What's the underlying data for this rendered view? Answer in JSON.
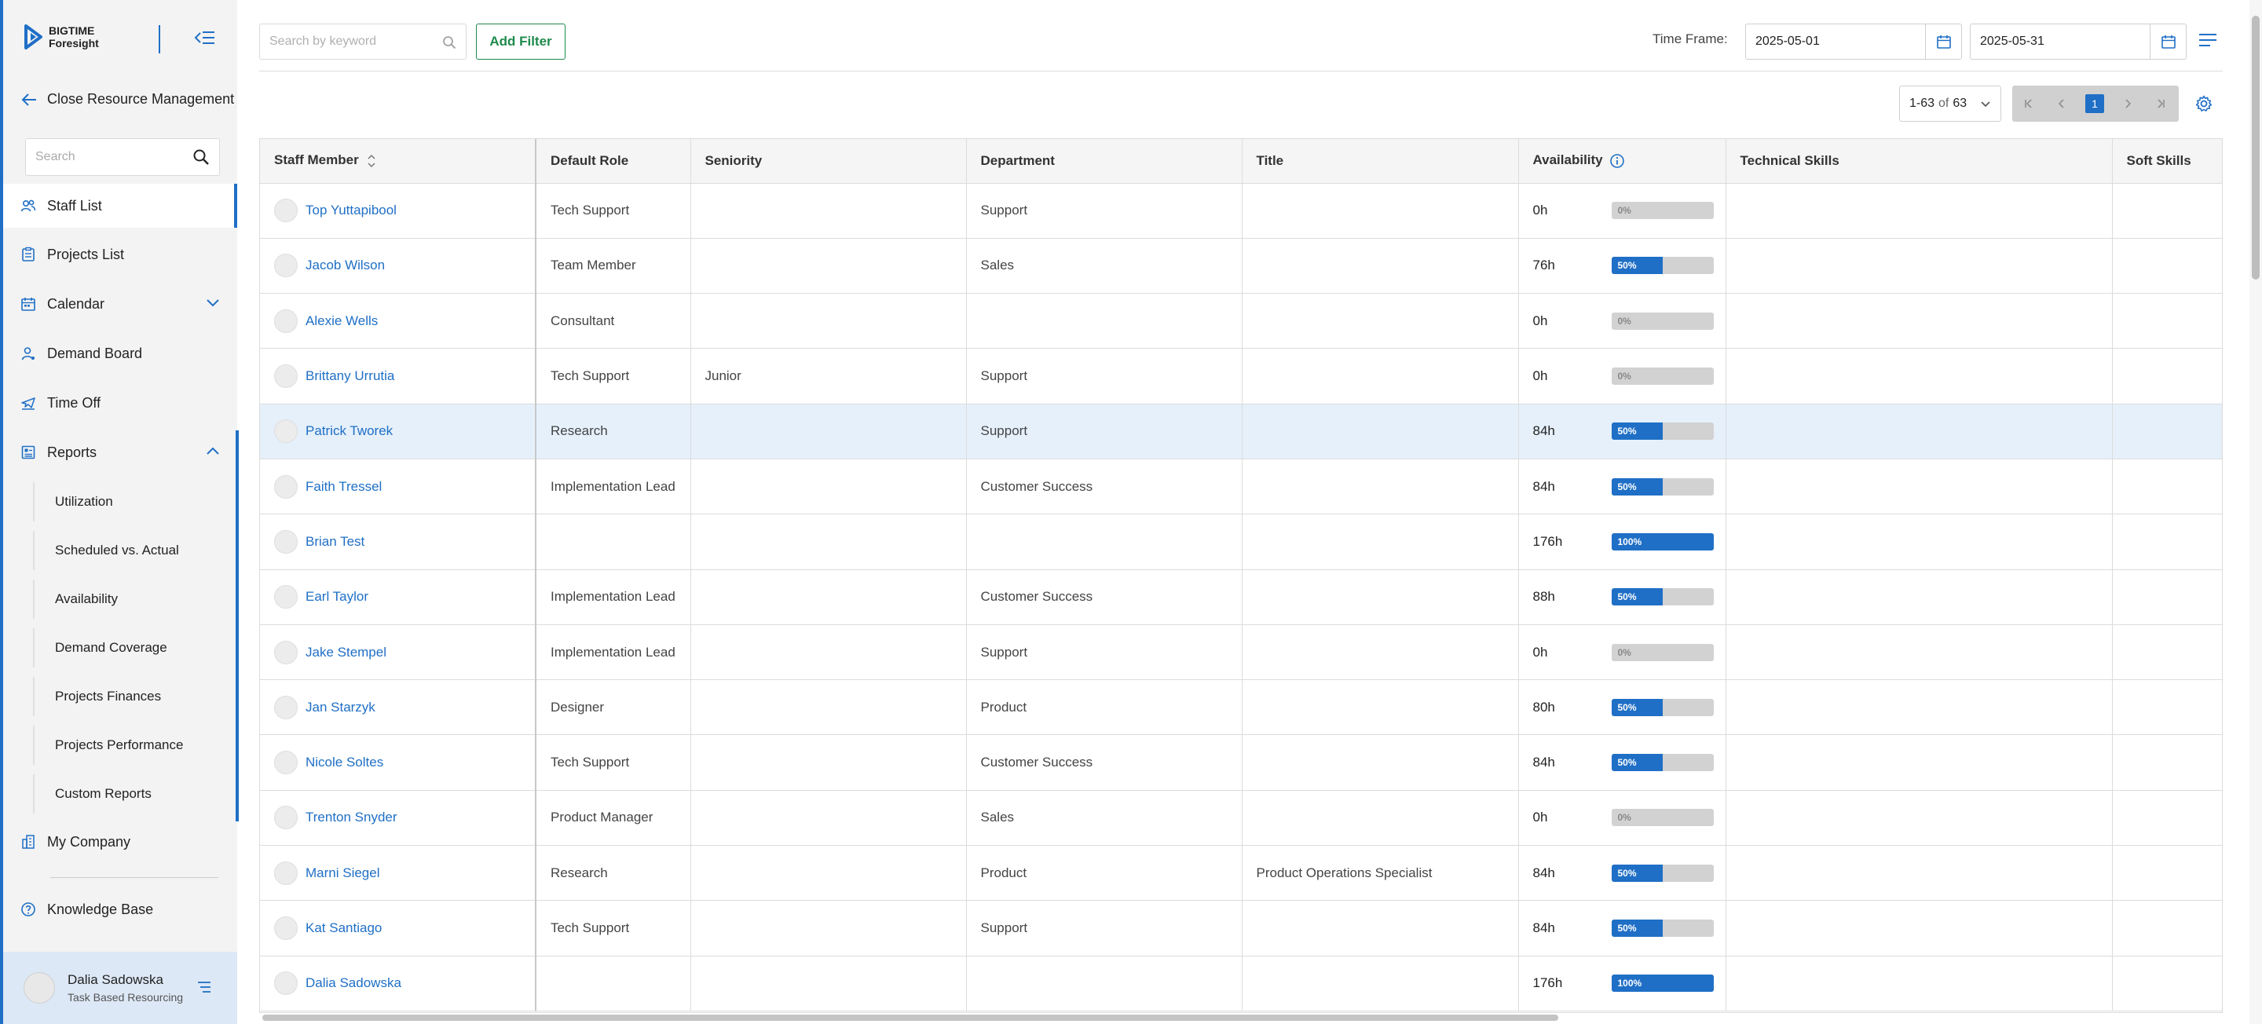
{
  "brand": {
    "line1": "BIGTIME",
    "line2": "Foresight"
  },
  "sidebar": {
    "back_label": "Close Resource Management",
    "search_placeholder": "Search",
    "items": [
      {
        "label": "Staff List",
        "icon": "users-icon",
        "active": true
      },
      {
        "label": "Projects List",
        "icon": "clipboard-icon"
      },
      {
        "label": "Calendar",
        "icon": "calendar-icon",
        "expanded": false
      },
      {
        "label": "Demand Board",
        "icon": "person-icon"
      },
      {
        "label": "Time Off",
        "icon": "plane-icon"
      },
      {
        "label": "Reports",
        "icon": "report-icon",
        "expanded": true
      }
    ],
    "report_items": [
      "Utilization",
      "Scheduled vs. Actual",
      "Availability",
      "Demand Coverage",
      "Projects Finances",
      "Projects Performance",
      "Custom Reports"
    ],
    "my_company": "My Company",
    "knowledge_base": "Knowledge Base",
    "user": {
      "name": "Dalia Sadowska",
      "role": "Task Based Resourcing"
    }
  },
  "toolbar": {
    "search_placeholder": "Search by keyword",
    "add_filter_label": "Add Filter",
    "time_frame_label": "Time Frame:",
    "start_date": "2025-05-01",
    "end_date": "2025-05-31"
  },
  "pagination": {
    "range": "1-63",
    "of_label": "of",
    "total": "63",
    "current_page": "1"
  },
  "table": {
    "columns": [
      "Staff Member",
      "Default Role",
      "Seniority",
      "Department",
      "Title",
      "Availability",
      "Technical Skills",
      "Soft Skills"
    ],
    "rows": [
      {
        "name": "Top Yuttapibool",
        "role": "Tech Support",
        "seniority": "",
        "department": "Support",
        "title": "",
        "hours": "0h",
        "pct": "0%",
        "fill": 0
      },
      {
        "name": "Jacob Wilson",
        "role": "Team Member",
        "seniority": "",
        "department": "Sales",
        "title": "",
        "hours": "76h",
        "pct": "50%",
        "fill": 0.5
      },
      {
        "name": "Alexie Wells",
        "role": "Consultant",
        "seniority": "",
        "department": "",
        "title": "",
        "hours": "0h",
        "pct": "0%",
        "fill": 0
      },
      {
        "name": "Brittany Urrutia",
        "role": "Tech Support",
        "seniority": "Junior",
        "department": "Support",
        "title": "",
        "hours": "0h",
        "pct": "0%",
        "fill": 0
      },
      {
        "name": "Patrick Tworek",
        "role": "Research",
        "seniority": "",
        "department": "Support",
        "title": "",
        "hours": "84h",
        "pct": "50%",
        "fill": 0.5,
        "highlight": true
      },
      {
        "name": "Faith Tressel",
        "role": "Implementation Lead",
        "seniority": "",
        "department": "Customer Success",
        "title": "",
        "hours": "84h",
        "pct": "50%",
        "fill": 0.5
      },
      {
        "name": "Brian Test",
        "role": "",
        "seniority": "",
        "department": "",
        "title": "",
        "hours": "176h",
        "pct": "100%",
        "fill": 1
      },
      {
        "name": "Earl Taylor",
        "role": "Implementation Lead",
        "seniority": "",
        "department": "Customer Success",
        "title": "",
        "hours": "88h",
        "pct": "50%",
        "fill": 0.5
      },
      {
        "name": "Jake Stempel",
        "role": "Implementation Lead",
        "seniority": "",
        "department": "Support",
        "title": "",
        "hours": "0h",
        "pct": "0%",
        "fill": 0
      },
      {
        "name": "Jan Starzyk",
        "role": "Designer",
        "seniority": "",
        "department": "Product",
        "title": "",
        "hours": "80h",
        "pct": "50%",
        "fill": 0.5
      },
      {
        "name": "Nicole Soltes",
        "role": "Tech Support",
        "seniority": "",
        "department": "Customer Success",
        "title": "",
        "hours": "84h",
        "pct": "50%",
        "fill": 0.5
      },
      {
        "name": "Trenton Snyder",
        "role": "Product Manager",
        "seniority": "",
        "department": "Sales",
        "title": "",
        "hours": "0h",
        "pct": "0%",
        "fill": 0
      },
      {
        "name": "Marni Siegel",
        "role": "Research",
        "seniority": "",
        "department": "Product",
        "title": "Product Operations Specialist",
        "hours": "84h",
        "pct": "50%",
        "fill": 0.5
      },
      {
        "name": "Kat Santiago",
        "role": "Tech Support",
        "seniority": "",
        "department": "Support",
        "title": "",
        "hours": "84h",
        "pct": "50%",
        "fill": 0.5
      },
      {
        "name": "Dalia Sadowska",
        "role": "",
        "seniority": "",
        "department": "",
        "title": "",
        "hours": "176h",
        "pct": "100%",
        "fill": 1
      }
    ]
  },
  "colors": {
    "accent": "#1f6fc6",
    "filter_green": "#1f8a4c",
    "highlight_row": "#e5f0fb"
  }
}
